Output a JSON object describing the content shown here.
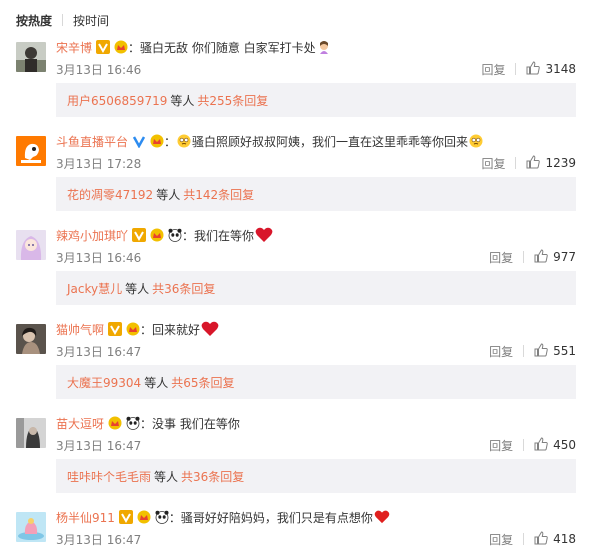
{
  "sort": {
    "hot_label": "按热度",
    "time_label": "按时间"
  },
  "reply_label": "回复",
  "comments": [
    {
      "name": "宋辛博",
      "text": "骚白无敌 你们随意 白家军打卡处",
      "time": "3月13日 16:46",
      "likes": "3148",
      "reply_user": "用户6506859719",
      "mid": "等人",
      "reply_count": "共255条回复"
    },
    {
      "name": "斗鱼直播平台",
      "text": "骚白照顾好叔叔阿姨，我们一直在这里乖乖等你回来",
      "time": "3月13日 17:28",
      "likes": "1239",
      "reply_user": "花的凋零47192",
      "mid": "等人",
      "reply_count": "共142条回复"
    },
    {
      "name": "辣鸡小加琪吖",
      "text": "我们在等你",
      "time": "3月13日 16:46",
      "likes": "977",
      "reply_user": "Jacky慧儿",
      "mid": "等人",
      "reply_count": "共36条回复"
    },
    {
      "name": "猫帅气啊",
      "text": "回来就好",
      "time": "3月13日 16:47",
      "likes": "551",
      "reply_user": "大魔王99304",
      "mid": "等人",
      "reply_count": "共65条回复"
    },
    {
      "name": "苗大逗呀",
      "text": "没事 我们在等你",
      "time": "3月13日 16:47",
      "likes": "450",
      "reply_user": "哇咔咔个毛毛雨",
      "mid": "等人",
      "reply_count": "共36条回复"
    },
    {
      "name": "杨半仙911",
      "text": "骚哥好好陪妈妈，我们只是有点想你",
      "time": "3月13日 16:47",
      "likes": "418"
    }
  ]
}
